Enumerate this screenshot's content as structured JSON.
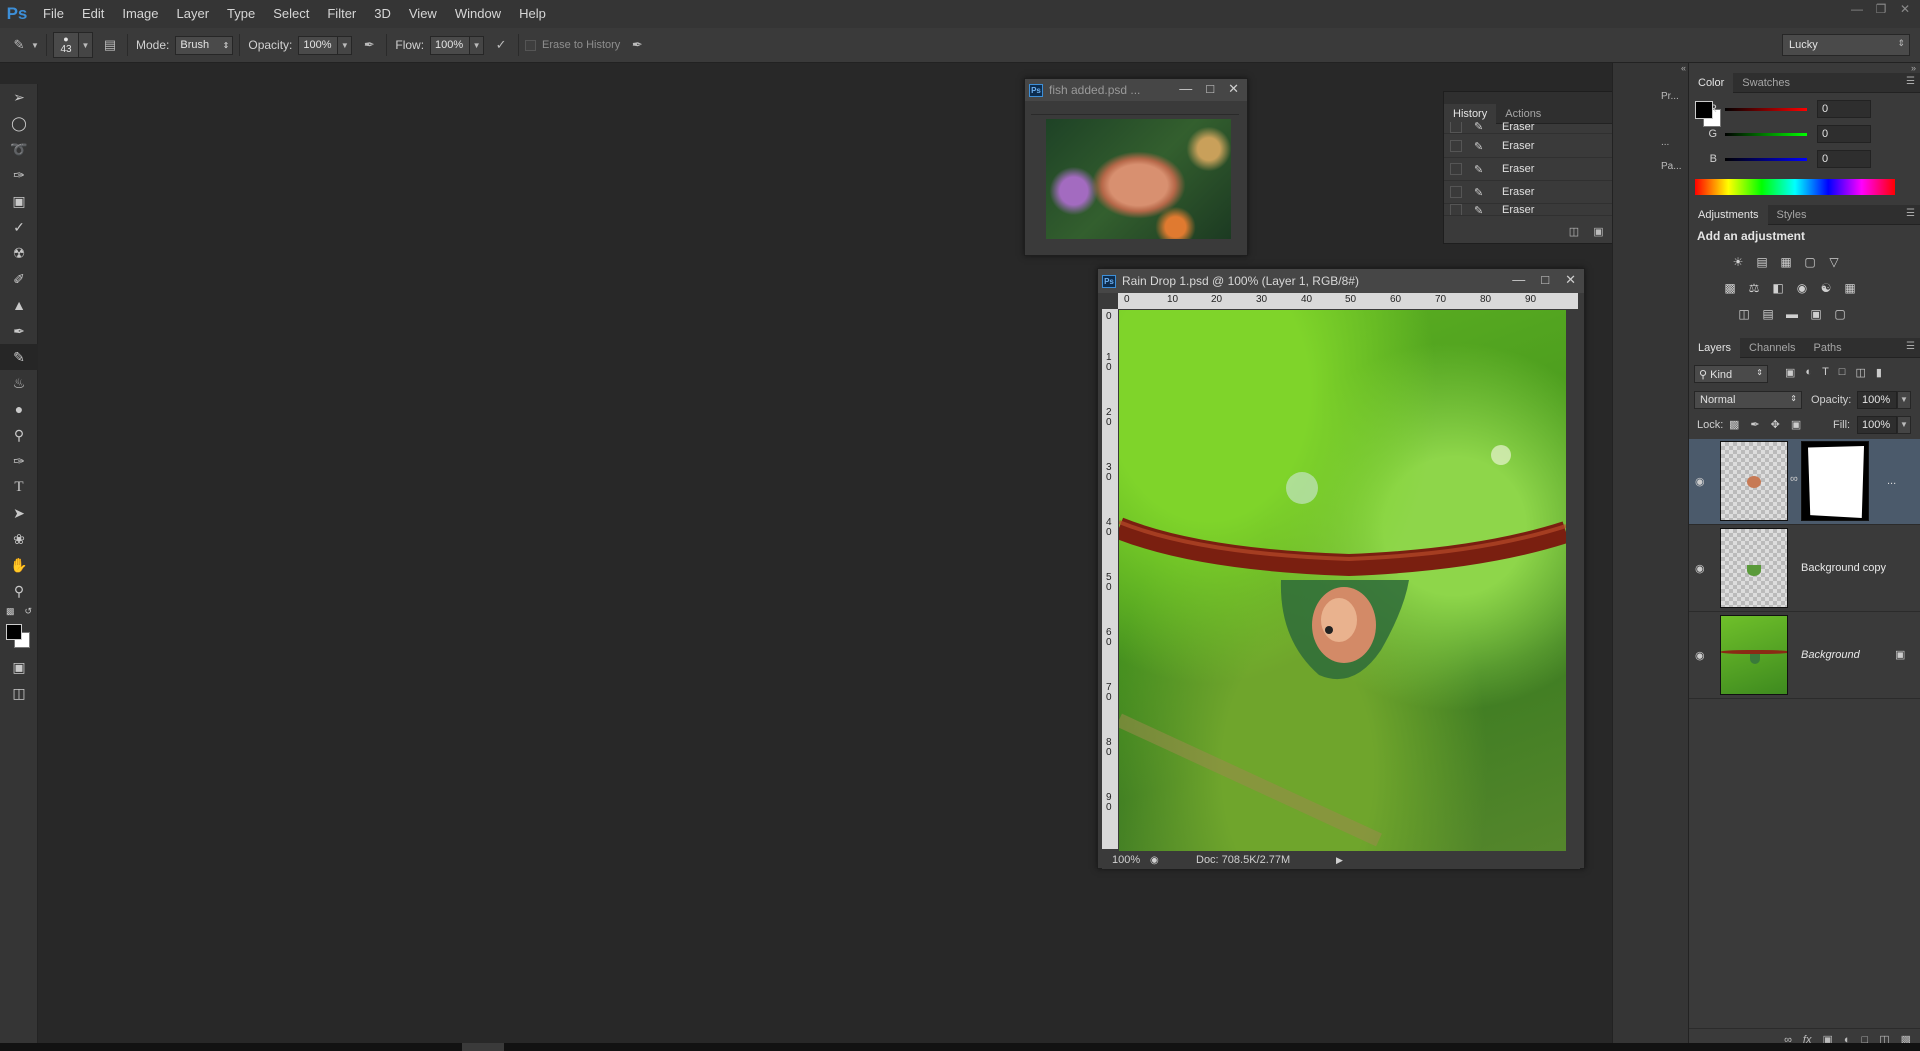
{
  "app": {
    "logo": "Ps"
  },
  "menu": [
    "File",
    "Edit",
    "Image",
    "Layer",
    "Type",
    "Select",
    "Filter",
    "3D",
    "View",
    "Window",
    "Help"
  ],
  "window_controls": [
    "minimize-icon",
    "restore-icon",
    "close-icon"
  ],
  "options_bar": {
    "brush_size": "43",
    "mode_label": "Mode:",
    "mode_value": "Brush",
    "opacity_label": "Opacity:",
    "opacity_value": "100%",
    "flow_label": "Flow:",
    "flow_value": "100%",
    "erase_to_history": "Erase to History",
    "workspace_preset": "Lucky"
  },
  "tools": [
    "move-icon",
    "marquee-icon",
    "lasso-icon",
    "quick-select-icon",
    "crop-icon",
    "eyedropper-icon",
    "healing-icon",
    "brush-icon",
    "clone-stamp-icon",
    "history-brush-icon",
    "eraser-icon",
    "paint-bucket-icon",
    "blur-icon",
    "dodge-icon",
    "pen-icon",
    "type-icon",
    "path-select-icon",
    "custom-shape-icon",
    "hand-icon",
    "zoom-icon"
  ],
  "colors": {
    "accent": "#3d8fd8",
    "foreground": "#000000",
    "background": "#ffffff"
  },
  "fish_doc": {
    "title": "fish added.psd ..."
  },
  "history": {
    "tabs": [
      "History",
      "Actions"
    ],
    "items": [
      "Eraser",
      "Eraser",
      "Eraser",
      "Eraser",
      "Eraser"
    ]
  },
  "main_doc": {
    "title": "Rain Drop 1.psd @ 100% (Layer 1, RGB/8#)",
    "ruler_h": [
      "0",
      "10",
      "20",
      "30",
      "40",
      "50",
      "60",
      "70",
      "80",
      "90"
    ],
    "ruler_v": [
      "0",
      "1 0",
      "2 0",
      "3 0",
      "4 0",
      "5 0",
      "6 0",
      "7 0",
      "8 0",
      "9 0"
    ],
    "zoom": "100%",
    "doc_info": "Doc: 708.5K/2.77M"
  },
  "dock_strip": {
    "label_1": "Pr...",
    "label_2": "...",
    "label_3": "Pa..."
  },
  "color_panel": {
    "tabs": [
      "Color",
      "Swatches"
    ],
    "r_label": "R",
    "r_value": "0",
    "g_label": "G",
    "g_value": "0",
    "b_label": "B",
    "b_value": "0"
  },
  "adjustments_panel": {
    "tabs": [
      "Adjustments",
      "Styles"
    ],
    "title": "Add an adjustment"
  },
  "layers_panel": {
    "tabs": [
      "Layers",
      "Channels",
      "Paths"
    ],
    "filter": "Kind",
    "blend_mode": "Normal",
    "opacity_label": "Opacity:",
    "opacity_value": "100%",
    "lock_label": "Lock:",
    "fill_label": "Fill:",
    "fill_value": "100%",
    "layers": [
      {
        "name": ""
      },
      {
        "name": "Background copy"
      },
      {
        "name": "Background"
      }
    ]
  }
}
